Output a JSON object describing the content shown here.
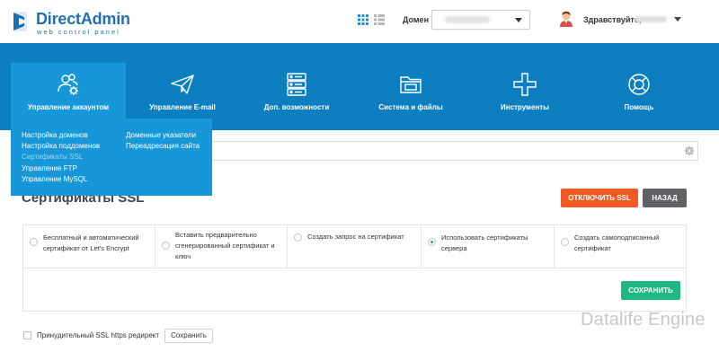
{
  "brand": {
    "name": "DirectAdmin",
    "tagline": "web control panel",
    "color": "#1f6fb7"
  },
  "topbar": {
    "view_icons": [
      "grid-view-icon",
      "list-view-icon"
    ],
    "domain_label": "Домен",
    "greeting": "Здравствуйте,"
  },
  "nav": {
    "background": "#0d7fc0",
    "active_background": "#1897d8",
    "items": [
      {
        "label": "Управление аккаунтом",
        "icon": "account-users-gear-icon"
      },
      {
        "label": "Управление E-mail",
        "icon": "paper-plane-icon"
      },
      {
        "label": "Доп. возможности",
        "icon": "server-stack-icon"
      },
      {
        "label": "Система и файлы",
        "icon": "folder-icon"
      },
      {
        "label": "Инструменты",
        "icon": "plus-icon"
      },
      {
        "label": "Помощь",
        "icon": "lifebuoy-icon"
      }
    ]
  },
  "dropdown": {
    "col1": [
      "Настройка доменов",
      "Настройка поддоменов",
      "Сертификаты SSL",
      "Управление FTP",
      "Управление MySQL"
    ],
    "col2": [
      "Доменные указатели",
      "Переадресация сайта"
    ],
    "current": "Сертификаты SSL"
  },
  "page": {
    "title": "Сертификаты SSL",
    "disable_ssl_button": "ОТКЛЮЧИТЬ SSL",
    "back_button": "НАЗАД",
    "disable_color": "#f05a22",
    "back_color": "#5f6165"
  },
  "options": [
    {
      "lines": [
        "Бесплатный и автоматический",
        "сертификат от Let's Encrypt"
      ],
      "checked": false
    },
    {
      "lines": [
        "Вставить предварительно",
        "сгенерированный сертификат и",
        "ключ"
      ],
      "checked": false
    },
    {
      "lines": [
        "Создать запрос на сертификат"
      ],
      "checked": false
    },
    {
      "lines": [
        "Использовать сертификаты",
        "сервера"
      ],
      "checked": true
    },
    {
      "lines": [
        "Создать самоподписанный",
        "сертификат"
      ],
      "checked": false
    }
  ],
  "save": {
    "label": "СОХРАНИТЬ",
    "color": "#1fb882"
  },
  "https": {
    "label": "Принудительный SSL https редирект",
    "checked": false,
    "save_label": "Сохранить"
  },
  "watermark": "Datalife Engine"
}
